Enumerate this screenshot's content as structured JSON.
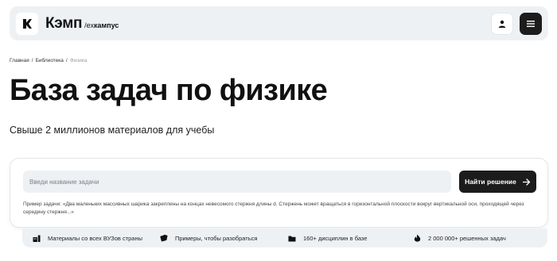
{
  "header": {
    "brand_name": "Кэмп",
    "brand_prefix": "/ех",
    "brand_old": "кампус",
    "icons": [
      "k-logo-icon",
      "user-icon",
      "menu-icon"
    ]
  },
  "breadcrumb": {
    "items": [
      "Главная",
      "Библиотека",
      "Физика"
    ],
    "separator": "/"
  },
  "page": {
    "title": "База задач по физике",
    "subtitle": "Свыше 2 миллионов материалов для учебы"
  },
  "search": {
    "placeholder": "Введи название задачи",
    "button_label": "Найти решение",
    "example_text": "Пример задачи: «Два маленьких массивных шарика закреплены на концах невесомого стержня длины d. Стержень может вращаться в горизонтальной плоскости вокруг вертикальной оси, проходящей через середину стержня...»"
  },
  "features": [
    {
      "label": "Материалы со всех ВУЗов страны",
      "icon": "university-icon"
    },
    {
      "label": "Примеры, чтобы разобраться",
      "icon": "cards-icon"
    },
    {
      "label": "160+ дисциплин в базе",
      "icon": "folder-icon"
    },
    {
      "label": "2 000 000+ решенных задач",
      "icon": "fire-icon"
    }
  ],
  "colors": {
    "accent": "#1c1c1c",
    "panel": "#eef1f4"
  }
}
